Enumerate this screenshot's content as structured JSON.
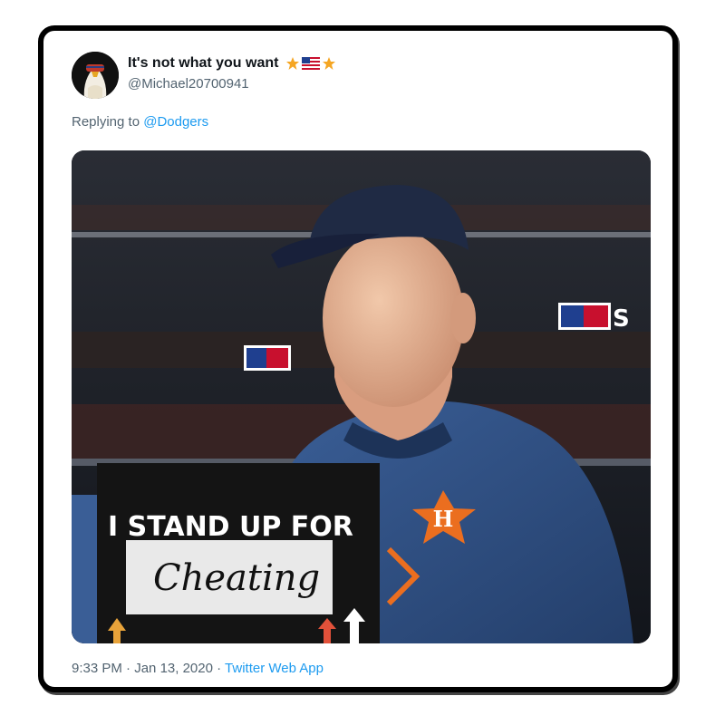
{
  "tweet": {
    "display_name": "It's not what you want",
    "name_emoji": [
      "star",
      "us-flag",
      "star"
    ],
    "handle": "@Michael20700941",
    "reply_prefix": "Replying to",
    "reply_to": "@Dodgers",
    "time": "9:33 PM",
    "separator_1": "·",
    "date": "Jan 13, 2020",
    "separator_2": "·",
    "source": "Twitter Web App"
  },
  "photo": {
    "sign_line_1": "I STAND UP FOR",
    "sign_word": "Cheating",
    "jersey_logo": "H",
    "banner_text": "S"
  },
  "colors": {
    "link": "#1d9bf0",
    "muted": "#536471",
    "text": "#0f1419",
    "hoodie": "#2a4a7c",
    "cap": "#1f2a44",
    "astros_orange": "#eb6e1f"
  }
}
